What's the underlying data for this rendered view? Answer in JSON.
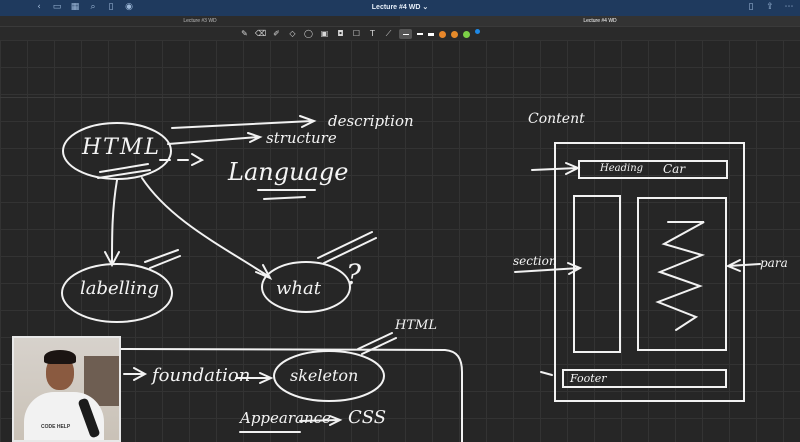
{
  "window": {
    "title": "Lecture #4 WD ⌄"
  },
  "tabs": [
    {
      "label": "Lecture #3 WD",
      "active": false
    },
    {
      "label": "Lecture #4 WD",
      "active": true
    }
  ],
  "titlebar_icons_left": [
    "chevron-left-icon",
    "sidebar-icon",
    "grid-icon",
    "search-icon",
    "bookmark-icon",
    "mic-icon"
  ],
  "titlebar_icons_right": [
    "bookmark-icon",
    "share-icon",
    "more-icon"
  ],
  "toolbar": {
    "tools": [
      "pen-icon",
      "eraser-icon",
      "highlighter-icon",
      "shapes-icon",
      "lasso-icon",
      "image-icon",
      "camera-icon",
      "sticker-icon",
      "text-icon",
      "laser-icon"
    ],
    "colors": [
      "#ffffff",
      "#ffffff",
      "#e8872a",
      "#e8872a",
      "#8ad04a",
      "#1e88e5"
    ]
  },
  "notes": {
    "html": "HTML",
    "description": "description",
    "structure": "structure",
    "language": "Language",
    "labelling": "labelling",
    "what": "what",
    "question": "?",
    "html2": "HTML",
    "foundation": "foundation",
    "skeleton": "skeleton",
    "appearance": "Appearance",
    "css": "CSS",
    "content": "Content",
    "heading": "Heading",
    "car": "Car",
    "section": "section",
    "para": "para",
    "footer": "Footer"
  },
  "webcam": {
    "brand": "CODE HELP"
  }
}
